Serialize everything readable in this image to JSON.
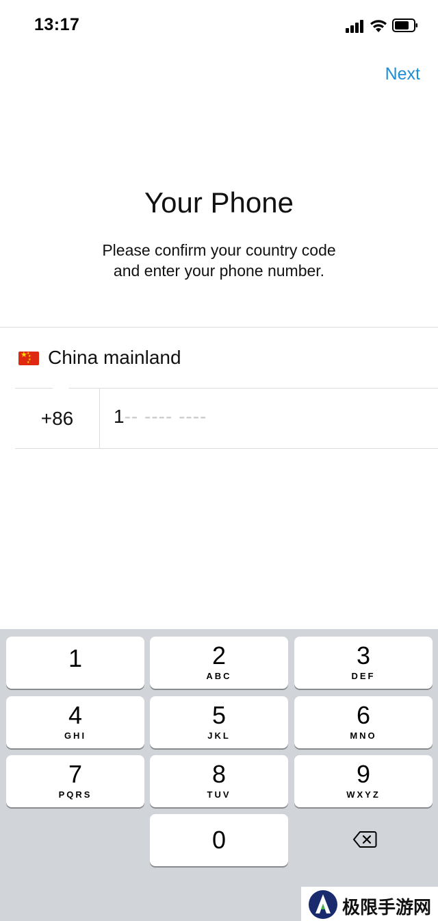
{
  "status_bar": {
    "time": "13:17",
    "signal_icon": "signal-bars-icon",
    "wifi_icon": "wifi-icon",
    "battery_icon": "battery-icon"
  },
  "header": {
    "next_label": "Next",
    "accent_color": "#1d8fd6"
  },
  "content": {
    "title": "Your Phone",
    "subtitle_line1": "Please confirm your country code",
    "subtitle_line2": "and enter your phone number."
  },
  "country": {
    "flag_icon": "china-flag-icon",
    "name": "China mainland"
  },
  "phone": {
    "country_code": "+86",
    "value": "1",
    "placeholder": "-- ---- ----"
  },
  "keypad": {
    "keys": [
      {
        "digit": "1",
        "letters": ""
      },
      {
        "digit": "2",
        "letters": "ABC"
      },
      {
        "digit": "3",
        "letters": "DEF"
      },
      {
        "digit": "4",
        "letters": "GHI"
      },
      {
        "digit": "5",
        "letters": "JKL"
      },
      {
        "digit": "6",
        "letters": "MNO"
      },
      {
        "digit": "7",
        "letters": "PQRS"
      },
      {
        "digit": "8",
        "letters": "TUV"
      },
      {
        "digit": "9",
        "letters": "WXYZ"
      },
      {
        "digit": "0",
        "letters": ""
      }
    ],
    "backspace_icon": "backspace-icon"
  },
  "watermark": {
    "text": "极限手游网",
    "logo_icon": "site-logo-icon"
  }
}
